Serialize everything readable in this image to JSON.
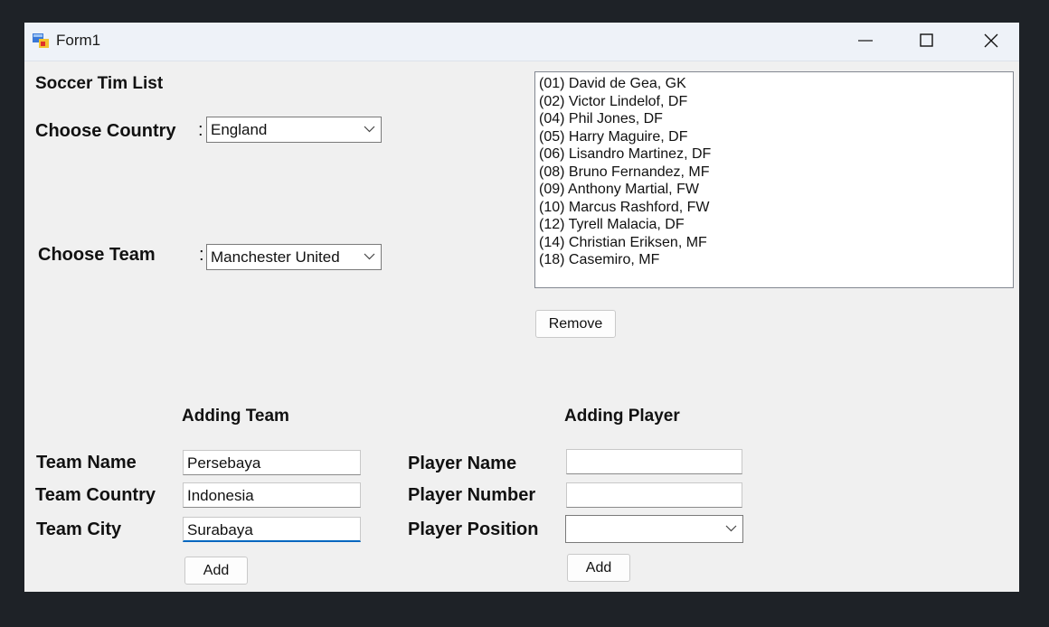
{
  "window": {
    "title": "Form1"
  },
  "header": {
    "title": "Soccer Tim List"
  },
  "country": {
    "label": "Choose Country",
    "separator": ":",
    "selected": "England"
  },
  "team": {
    "label": "Choose Team",
    "separator": ":",
    "selected": "Manchester United"
  },
  "players_list": {
    "items": [
      "(01) David de Gea, GK",
      "(02) Victor Lindelof, DF",
      "(04) Phil Jones, DF",
      "(05) Harry Maguire, DF",
      "(06) Lisandro Martinez, DF",
      "(08) Bruno Fernandez, MF",
      "(09) Anthony Martial, FW",
      "(10) Marcus Rashford, FW",
      "(12) Tyrell Malacia, DF",
      "(14) Christian Eriksen, MF",
      "(18) Casemiro, MF"
    ]
  },
  "remove_button": "Remove",
  "adding_team": {
    "header": "Adding Team",
    "name_label": "Team Name",
    "name_value": "Persebaya",
    "country_label": "Team Country",
    "country_value": "Indonesia",
    "city_label": "Team City",
    "city_value": "Surabaya",
    "add_button": "Add"
  },
  "adding_player": {
    "header": "Adding Player",
    "name_label": "Player Name",
    "name_value": "",
    "number_label": "Player Number",
    "number_value": "",
    "position_label": "Player Position",
    "position_value": "",
    "add_button": "Add"
  }
}
